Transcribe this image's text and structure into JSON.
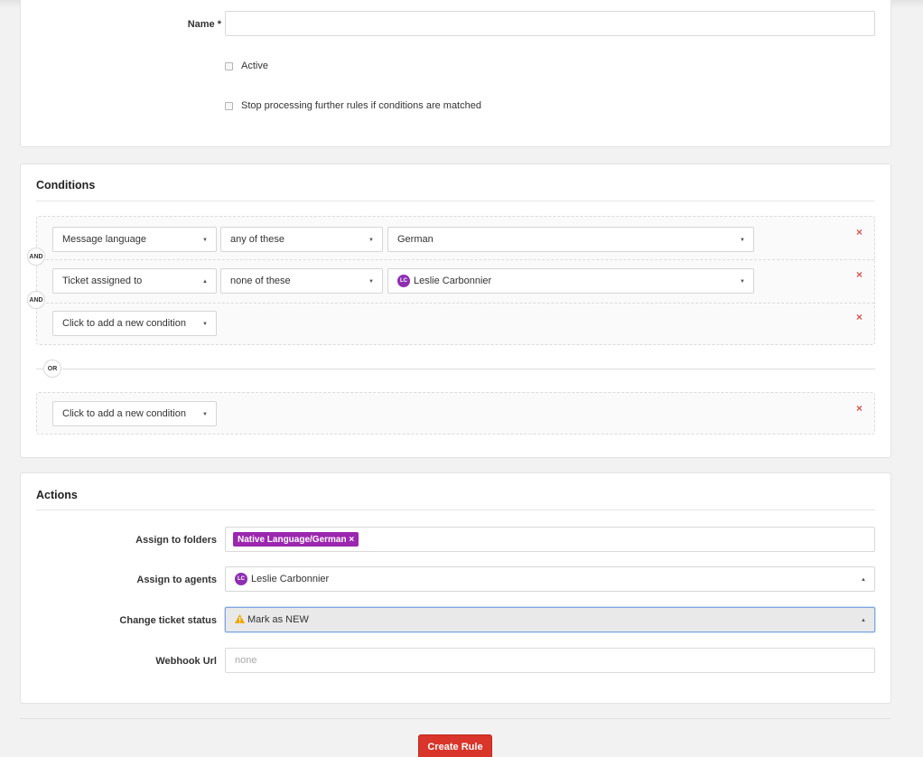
{
  "general": {
    "name_label": "Name *",
    "name_value": "",
    "active_label": "Active",
    "stop_label": "Stop processing further rules if conditions are matched"
  },
  "conditions": {
    "title": "Conditions",
    "rows": [
      {
        "field": "Message language",
        "operator": "any of these",
        "value": "German"
      },
      {
        "field": "Ticket assigned to",
        "operator": "none of these",
        "value": "Leslie Carbonnier",
        "avatar": "LC"
      }
    ],
    "add_condition_label": "Click to add a new condition",
    "and_label": "AND",
    "or_label": "OR",
    "remove_glyph": "×"
  },
  "actions": {
    "title": "Actions",
    "folders_label": "Assign to folders",
    "folder_tag": "Native Language/German ×",
    "agents_label": "Assign to agents",
    "agent_name": "Leslie Carbonnier",
    "agent_avatar": "LC",
    "status_label": "Change ticket status",
    "status_value": "Mark as NEW",
    "webhook_label": "Webhook Url",
    "webhook_placeholder": "none"
  },
  "create_button": "Create Rule",
  "colors": {
    "danger": "#d9352b",
    "tag": "#9b27af",
    "avatar": "#8e2fb3",
    "warning": "#f0a500"
  }
}
